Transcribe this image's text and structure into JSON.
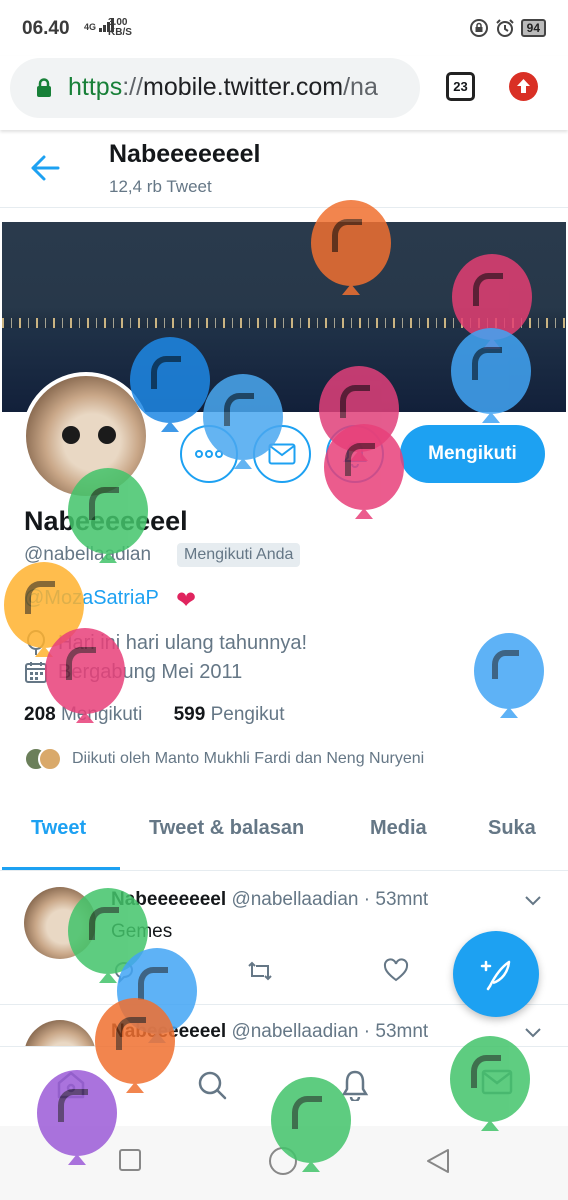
{
  "statusbar": {
    "time": "06.40",
    "signal": "4G",
    "speed_value": "3.00",
    "speed_unit": "KB/S",
    "battery": "94"
  },
  "browser": {
    "url_scheme": "https",
    "url_sep": "://",
    "url_host": "mobile.twitter.com",
    "url_rest": "/na",
    "tab_count": "23"
  },
  "header": {
    "name": "Nabeeeeeeel",
    "tweet_count": "12,4 rb Tweet"
  },
  "profile": {
    "name": "Nabeeeeeeel",
    "handle": "@nabellaadian",
    "follows_you_badge": "Mengikuti Anda",
    "bio_mention": "@MozaSatriaP",
    "birthday_text": "Hari ini hari ulang tahunnya!",
    "joined_text": "Bergabung Mei 2011",
    "following_count": "208",
    "following_label": "Mengikuti",
    "followers_count": "599",
    "followers_label": "Pengikut",
    "followed_by_text": "Diikuti oleh Manto Mukhli Fardi dan Neng Nuryeni",
    "follow_button_label": "Mengikuti"
  },
  "tabs": [
    "Tweet",
    "Tweet & balasan",
    "Media",
    "Suka"
  ],
  "tweets": [
    {
      "name": "Nabeeeeeeel",
      "handle": "@nabellaadian",
      "sep": "·",
      "time": "53mnt",
      "text": "Gemes"
    },
    {
      "name": "Nabeeeeeeel",
      "handle": "@nabellaadian",
      "sep": "·",
      "time": "53mnt",
      "text": ""
    }
  ],
  "colors": {
    "accent": "#1da1f2",
    "heart": "#e0245e",
    "update": "#d93025"
  },
  "icons": {
    "back": "arrow-left-icon",
    "more": "more-dots-icon",
    "message": "envelope-icon",
    "notify": "bell-plus-icon",
    "compose": "feather-plus-icon",
    "home": "home-icon",
    "search": "search-icon",
    "notifications": "bell-icon",
    "dm": "mail-icon"
  }
}
